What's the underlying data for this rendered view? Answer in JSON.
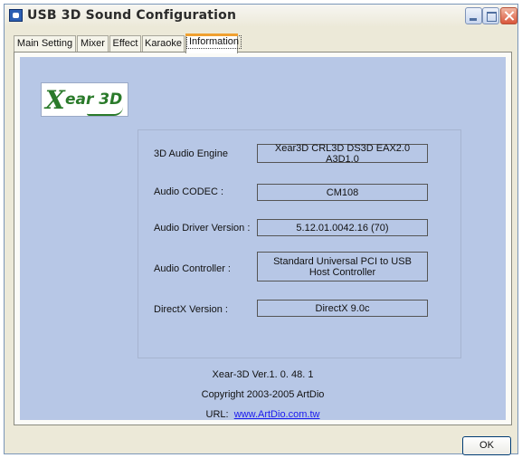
{
  "window": {
    "title": "USB 3D Sound Configuration"
  },
  "tabs": [
    {
      "label": "Main Setting"
    },
    {
      "label": "Mixer"
    },
    {
      "label": "Effect"
    },
    {
      "label": "Karaoke"
    },
    {
      "label": "Information",
      "active": true
    }
  ],
  "logo": {
    "text_x": "X",
    "text_rest": "ear 3D"
  },
  "info": {
    "rows": [
      {
        "label": "3D Audio Engine",
        "value": "Xear3D  CRL3D  DS3D  EAX2.0  A3D1.0"
      },
      {
        "label": "Audio CODEC :",
        "value": "CM108"
      },
      {
        "label": "Audio Driver Version :",
        "value": "5.12.01.0042.16 (70)"
      },
      {
        "label": "Audio Controller :",
        "value": "Standard Universal PCI to USB Host Controller"
      },
      {
        "label": "DirectX Version :",
        "value": "DirectX 9.0c"
      }
    ]
  },
  "footer": {
    "version": "Xear-3D Ver.1. 0. 48. 1",
    "copyright": "Copyright 2003-2005 ArtDio",
    "url_label": "URL:",
    "url": "www.ArtDio.com.tw"
  },
  "buttons": {
    "ok": "OK"
  },
  "colors": {
    "content_bg": "#b7c7e6",
    "active_tab_accent": "#f0a030",
    "link": "#1a1aee"
  }
}
